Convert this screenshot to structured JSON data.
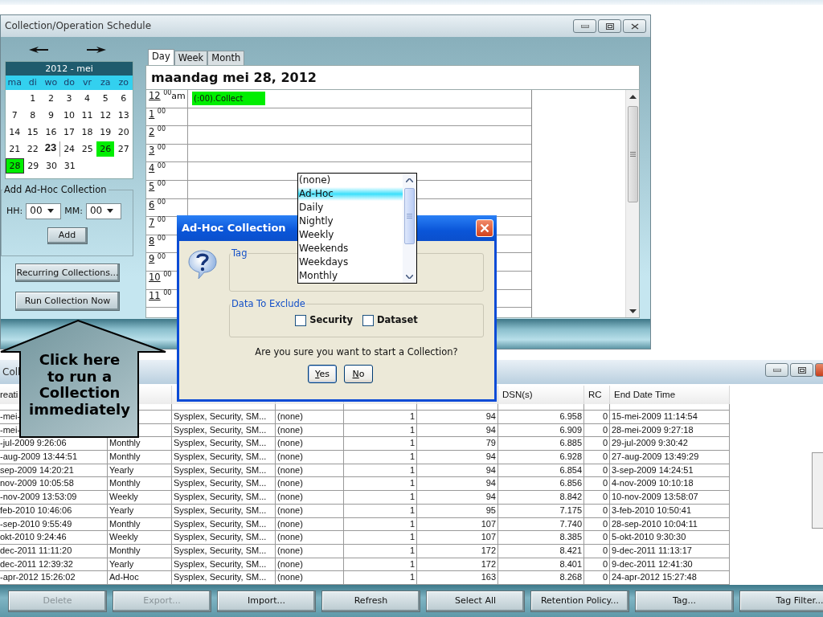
{
  "schedule_window": {
    "title": "Collection/Operation Schedule",
    "calendar": {
      "title": "2012 - mei",
      "weekdays": [
        "ma",
        "di",
        "wo",
        "do",
        "vr",
        "za",
        "zo"
      ],
      "weeks": [
        [
          {
            "day": "1",
            "selected": false,
            "marked": false,
            "today": false
          },
          {
            "day": "2",
            "selected": false,
            "marked": false,
            "today": false
          },
          {
            "day": "3",
            "selected": false,
            "marked": false,
            "today": false
          },
          {
            "day": "4",
            "selected": false,
            "marked": false,
            "today": false
          },
          {
            "day": "5",
            "selected": false,
            "marked": false,
            "today": false
          },
          {
            "day": "6",
            "selected": false,
            "marked": false,
            "today": false
          }
        ],
        [
          {
            "day": "7",
            "selected": false,
            "marked": false,
            "today": false
          },
          {
            "day": "8",
            "selected": false,
            "marked": false,
            "today": false
          },
          {
            "day": "9",
            "selected": false,
            "marked": false,
            "today": false
          },
          {
            "day": "10",
            "selected": false,
            "marked": false,
            "today": false
          },
          {
            "day": "11",
            "selected": false,
            "marked": false,
            "today": false
          },
          {
            "day": "12",
            "selected": false,
            "marked": false,
            "today": false
          },
          {
            "day": "13",
            "selected": false,
            "marked": false,
            "today": false
          }
        ],
        [
          {
            "day": "14",
            "selected": false,
            "marked": false,
            "today": false
          },
          {
            "day": "15",
            "selected": false,
            "marked": false,
            "today": false
          },
          {
            "day": "16",
            "selected": false,
            "marked": false,
            "today": false
          },
          {
            "day": "17",
            "selected": false,
            "marked": false,
            "today": false
          },
          {
            "day": "18",
            "selected": false,
            "marked": false,
            "today": false
          },
          {
            "day": "19",
            "selected": false,
            "marked": false,
            "today": false
          },
          {
            "day": "20",
            "selected": false,
            "marked": false,
            "today": false
          }
        ],
        [
          {
            "day": "21",
            "selected": false,
            "marked": false,
            "today": false
          },
          {
            "day": "22",
            "selected": false,
            "marked": false,
            "today": false
          },
          {
            "day": "23",
            "selected": false,
            "marked": false,
            "today": true
          },
          {
            "day": "24",
            "selected": false,
            "marked": false,
            "today": false
          },
          {
            "day": "25",
            "selected": false,
            "marked": false,
            "today": false
          },
          {
            "day": "26",
            "selected": false,
            "marked": true,
            "today": false
          },
          {
            "day": "27",
            "selected": false,
            "marked": false,
            "today": false
          }
        ],
        [
          {
            "day": "28",
            "selected": true,
            "marked": true,
            "today": false
          },
          {
            "day": "29",
            "selected": false,
            "marked": false,
            "today": false
          },
          {
            "day": "30",
            "selected": false,
            "marked": false,
            "today": false
          },
          {
            "day": "31",
            "selected": false,
            "marked": false,
            "today": false
          }
        ]
      ]
    },
    "ad_hoc": {
      "legend": "Add Ad-Hoc Collection",
      "hh_label": "HH:",
      "hh_value": "00",
      "mm_label": "MM:",
      "mm_value": "00",
      "add_button": "Add"
    },
    "buttons": [
      "Recurring Collections...",
      "Run Collection Now"
    ],
    "tabs": [
      {
        "label": "Day",
        "selected": true
      },
      {
        "label": "Week",
        "selected": false
      },
      {
        "label": "Month",
        "selected": false
      }
    ],
    "date_heading": "maandag mei 28, 2012",
    "hours": [
      {
        "hour": "12",
        "minutes": "00",
        "suffix": "am",
        "event": "(:00).Collect"
      },
      {
        "hour": "1",
        "minutes": "00"
      },
      {
        "hour": "2",
        "minutes": "00"
      },
      {
        "hour": "3",
        "minutes": "00"
      },
      {
        "hour": "4",
        "minutes": "00"
      },
      {
        "hour": "5",
        "minutes": "00"
      },
      {
        "hour": "6",
        "minutes": "00"
      },
      {
        "hour": "7",
        "minutes": "00"
      },
      {
        "hour": "8",
        "minutes": "00"
      },
      {
        "hour": "9",
        "minutes": "00"
      },
      {
        "hour": "10",
        "minutes": "00"
      },
      {
        "hour": "11",
        "minutes": "00"
      }
    ]
  },
  "dropdown_list": {
    "items": [
      {
        "label": "(none)",
        "selected": false
      },
      {
        "label": "Ad-Hoc",
        "selected": true
      },
      {
        "label": "Daily",
        "selected": false
      },
      {
        "label": "Nightly",
        "selected": false
      },
      {
        "label": "Weekly",
        "selected": false
      },
      {
        "label": "Weekends",
        "selected": false
      },
      {
        "label": "Weekdays",
        "selected": false
      },
      {
        "label": "Monthly",
        "selected": false
      }
    ]
  },
  "dialog": {
    "title": "Ad-Hoc Collection",
    "tag_legend": "Tag",
    "exclude_legend": "Data To Exclude",
    "checkboxes": [
      {
        "label": "Security",
        "checked": false
      },
      {
        "label": "Dataset",
        "checked": false
      }
    ],
    "question": "Are you sure you want to start a Collection?",
    "buttons": [
      "Yes",
      "No"
    ]
  },
  "callout": {
    "text": "Click here\nto run a\nCollection\nimmediately"
  },
  "collections_window": {
    "title": "Coll",
    "column_headers": {
      "creation": "reati",
      "dsn": "DSN(s)",
      "rc": "RC",
      "end_date_time": "End Date Time"
    },
    "rows": [
      {
        "creation": "-mei-",
        "column_3": "Sysplex, Security, SM...",
        "column_4": "(none)",
        "column_5": "1",
        "column_6": "94",
        "dsn": "6.958",
        "rc": "0",
        "end_date_time": "15-mei-2009 11:14:54"
      },
      {
        "creation": "-mei-",
        "column_3": "Sysplex, Security, SM...",
        "column_4": "(none)",
        "column_5": "1",
        "column_6": "94",
        "dsn": "6.909",
        "rc": "0",
        "end_date_time": "28-mei-2009 9:27:18"
      },
      {
        "creation": "-jul-2009 9:26:06",
        "tag": "Monthly",
        "column_3": "Sysplex, Security, SM...",
        "column_4": "(none)",
        "column_5": "1",
        "column_6": "79",
        "dsn": "6.885",
        "rc": "0",
        "end_date_time": "29-jul-2009 9:30:42"
      },
      {
        "creation": "-aug-2009 13:44:51",
        "tag": "Monthly",
        "column_3": "Sysplex, Security, SM...",
        "column_4": "(none)",
        "column_5": "1",
        "column_6": "94",
        "dsn": "6.928",
        "rc": "0",
        "end_date_time": "27-aug-2009 13:49:29"
      },
      {
        "creation": "sep-2009 14:20:21",
        "tag": "Yearly",
        "column_3": "Sysplex, Security, SM...",
        "column_4": "(none)",
        "column_5": "1",
        "column_6": "94",
        "dsn": "6.854",
        "rc": "0",
        "end_date_time": "3-sep-2009 14:24:51"
      },
      {
        "creation": "nov-2009 10:05:58",
        "tag": "Monthly",
        "column_3": "Sysplex, Security, SM...",
        "column_4": "(none)",
        "column_5": "1",
        "column_6": "94",
        "dsn": "6.856",
        "rc": "0",
        "end_date_time": "4-nov-2009 10:10:18"
      },
      {
        "creation": "-nov-2009 13:53:09",
        "tag": "Weekly",
        "column_3": "Sysplex, Security, SM...",
        "column_4": "(none)",
        "column_5": "1",
        "column_6": "94",
        "dsn": "8.842",
        "rc": "0",
        "end_date_time": "10-nov-2009 13:58:07"
      },
      {
        "creation": "feb-2010 10:46:06",
        "tag": "Yearly",
        "column_3": "Sysplex, Security, SM...",
        "column_4": "(none)",
        "column_5": "1",
        "column_6": "95",
        "dsn": "7.175",
        "rc": "0",
        "end_date_time": "3-feb-2010 10:50:41"
      },
      {
        "creation": "-sep-2010 9:55:49",
        "tag": "Monthly",
        "column_3": "Sysplex, Security, SM...",
        "column_4": "(none)",
        "column_5": "1",
        "column_6": "107",
        "dsn": "7.740",
        "rc": "0",
        "end_date_time": "28-sep-2010 10:04:11"
      },
      {
        "creation": "okt-2010 9:24:46",
        "tag": "Weekly",
        "column_3": "Sysplex, Security, SM...",
        "column_4": "(none)",
        "column_5": "1",
        "column_6": "107",
        "dsn": "8.385",
        "rc": "0",
        "end_date_time": "5-okt-2010 9:30:30"
      },
      {
        "creation": "dec-2011 11:11:20",
        "tag": "Monthly",
        "column_3": "Sysplex, Security, SM...",
        "column_4": "(none)",
        "column_5": "1",
        "column_6": "172",
        "dsn": "8.421",
        "rc": "0",
        "end_date_time": "9-dec-2011 11:13:17"
      },
      {
        "creation": "dec-2011 12:39:32",
        "tag": "Yearly",
        "column_3": "Sysplex, Security, SM...",
        "column_4": "(none)",
        "column_5": "1",
        "column_6": "172",
        "dsn": "8.401",
        "rc": "0",
        "end_date_time": "9-dec-2011 12:41:30"
      },
      {
        "creation": "-apr-2012 15:26:02",
        "tag": "Ad-Hoc",
        "column_3": "Sysplex, Security, SM...",
        "column_4": "(none)",
        "column_5": "1",
        "column_6": "163",
        "dsn": "8.268",
        "rc": "0",
        "end_date_time": "24-apr-2012 15:27:48"
      }
    ],
    "buttons": [
      {
        "label": "Delete",
        "disabled": true
      },
      {
        "label": "Export...",
        "disabled": true
      },
      {
        "label": "Import...",
        "disabled": false
      },
      {
        "label": "Refresh",
        "disabled": false
      },
      {
        "label": "Select All",
        "disabled": false
      },
      {
        "label": "Retention Policy...",
        "disabled": false
      },
      {
        "label": "Tag...",
        "disabled": false
      },
      {
        "label": "Tag Filter...",
        "disabled": false
      }
    ]
  }
}
